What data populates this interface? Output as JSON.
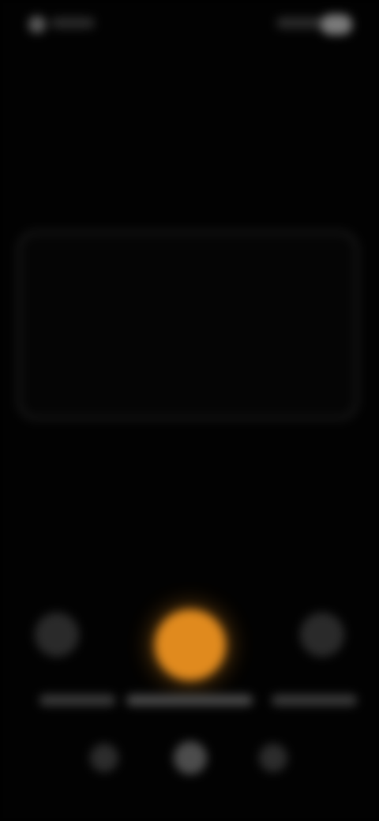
{
  "app": {
    "name": "",
    "accent_color": "#e08a1e"
  },
  "status_bar": {
    "time": "",
    "icons": [
      "signal-icon",
      "wifi-icon",
      "battery-icon"
    ]
  },
  "scanner": {
    "frame_label": ""
  },
  "controls": {
    "left_icon": "image-icon",
    "shutter_icon": "shutter-icon",
    "right_icon": "flash-icon"
  },
  "modes": [
    {
      "label": ""
    },
    {
      "label": ""
    },
    {
      "label": ""
    }
  ],
  "nav": {
    "items": [
      "back-icon",
      "home-icon",
      "recents-icon"
    ]
  }
}
